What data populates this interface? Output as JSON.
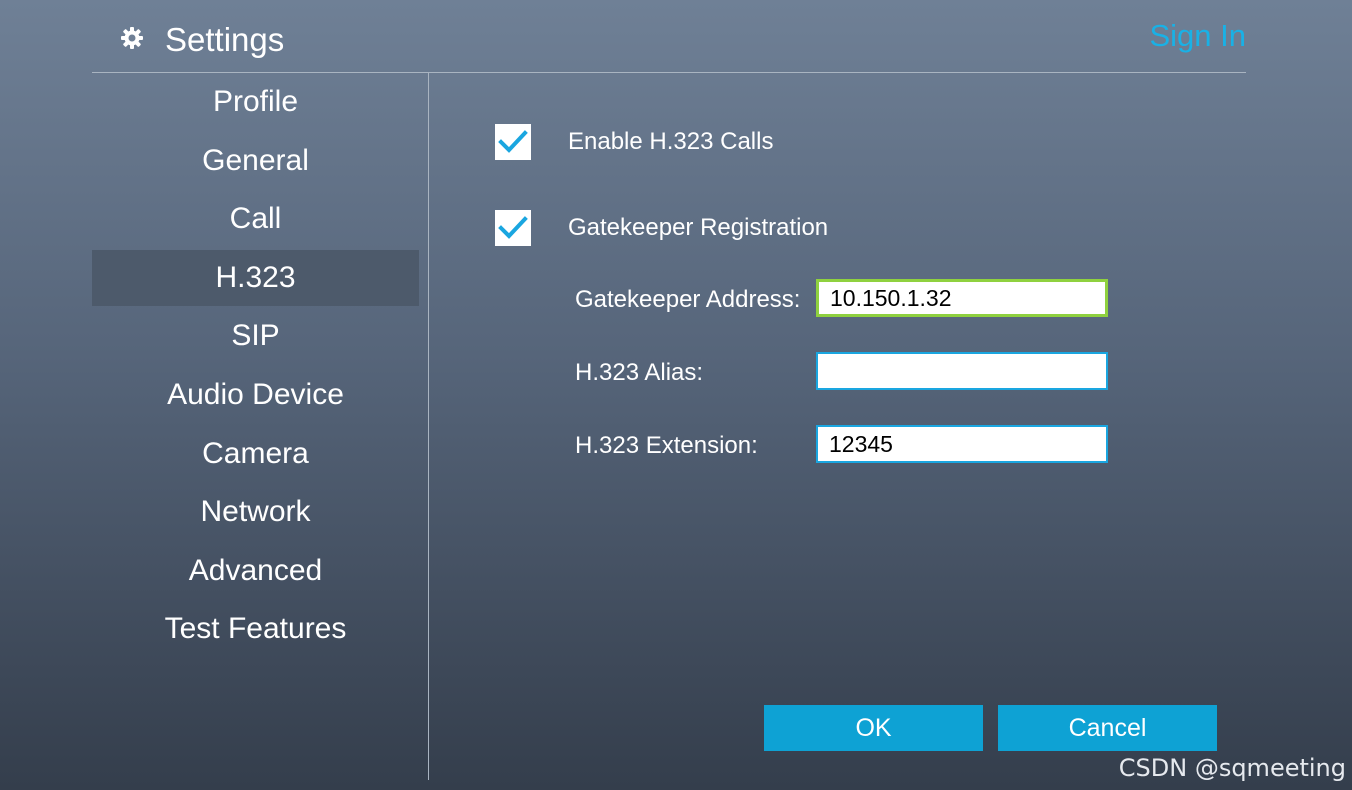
{
  "header": {
    "title": "Settings",
    "sign_in": "Sign In",
    "gear_icon": "gear-icon"
  },
  "sidebar": {
    "items": [
      {
        "label": "Profile"
      },
      {
        "label": "General"
      },
      {
        "label": "Call"
      },
      {
        "label": "H.323",
        "selected": true
      },
      {
        "label": "SIP"
      },
      {
        "label": "Audio Device"
      },
      {
        "label": "Camera"
      },
      {
        "label": "Network"
      },
      {
        "label": "Advanced"
      },
      {
        "label": "Test Features"
      }
    ]
  },
  "main": {
    "enable_h323": {
      "label": "Enable H.323 Calls",
      "checked": true
    },
    "gatekeeper_registration": {
      "label": "Gatekeeper Registration",
      "checked": true
    },
    "fields": {
      "gatekeeper_address": {
        "label": "Gatekeeper Address:",
        "value": "10.150.1.32"
      },
      "alias": {
        "label": "H.323 Alias:",
        "value": ""
      },
      "extension": {
        "label": "H.323 Extension:",
        "value": "12345"
      }
    }
  },
  "buttons": {
    "ok": "OK",
    "cancel": "Cancel"
  },
  "colors": {
    "accent": "#0ea2d4",
    "sign_in": "#19b1e6",
    "check": "#1aa6e0",
    "focus": "#8fd13f"
  },
  "watermark": "CSDN @sqmeeting"
}
